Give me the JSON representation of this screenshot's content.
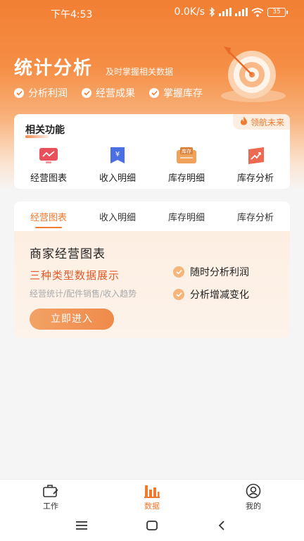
{
  "status_bar": {
    "time": "下午4:53",
    "network_speed": "0.0K/s",
    "battery": "35"
  },
  "header": {
    "title": "统计分析",
    "subtitle": "及时掌握相关数据",
    "features": [
      "分析利润",
      "经营成果",
      "掌握库存"
    ]
  },
  "related": {
    "title": "相关功能",
    "badge": "领航未来",
    "items": [
      {
        "label": "经营图表",
        "icon": "chart-monitor-icon"
      },
      {
        "label": "收入明细",
        "icon": "yen-bookmark-icon"
      },
      {
        "label": "库存明细",
        "icon": "inventory-box-icon",
        "icon_text": "库存"
      },
      {
        "label": "库存分析",
        "icon": "trend-card-icon"
      }
    ]
  },
  "tabs": {
    "items": [
      "经营图表",
      "收入明细",
      "库存明细",
      "库存分析"
    ],
    "active_index": 0
  },
  "panel": {
    "title": "商家经营图表",
    "subtitle": "三种类型数据展示",
    "description": "经营统计/配件销售/收入趋势",
    "bullets": [
      "随时分析利润",
      "分析增减变化"
    ],
    "button": "立即进入"
  },
  "tabbar": {
    "items": [
      {
        "label": "工作",
        "icon": "briefcase-icon"
      },
      {
        "label": "数据",
        "icon": "bar-chart-icon"
      },
      {
        "label": "我的",
        "icon": "user-icon"
      }
    ],
    "active_index": 1
  },
  "colors": {
    "accent": "#f07a2e",
    "hero_top": "#f27f33",
    "highlight_text": "#e05a2a"
  }
}
